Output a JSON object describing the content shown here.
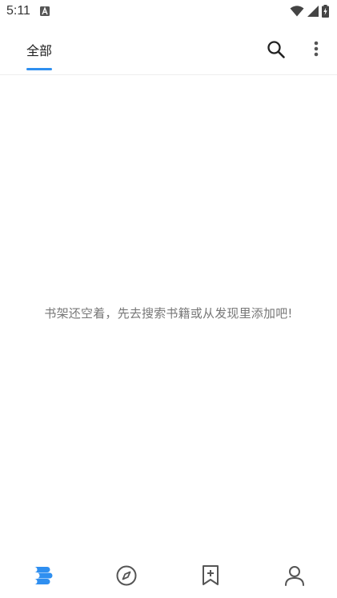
{
  "status_bar": {
    "time": "5:11",
    "icons": [
      "notification-a-icon",
      "wifi-icon",
      "cell-signal-icon",
      "battery-charging-icon"
    ]
  },
  "header": {
    "tabs": [
      {
        "label": "全部",
        "selected": true
      }
    ],
    "actions": [
      "search-icon",
      "more-vert-icon"
    ],
    "accent_color": "#2f8ff0"
  },
  "main": {
    "empty_message": "书架还空着，先去搜索书籍或从发现里添加吧!"
  },
  "bottom_nav": {
    "items": [
      {
        "icon": "bookshelf-icon",
        "selected": true
      },
      {
        "icon": "compass-icon",
        "selected": false
      },
      {
        "icon": "bookmark-add-icon",
        "selected": false
      },
      {
        "icon": "person-icon",
        "selected": false
      }
    ],
    "active_color": "#2f8ff0",
    "inactive_color": "#555555"
  }
}
